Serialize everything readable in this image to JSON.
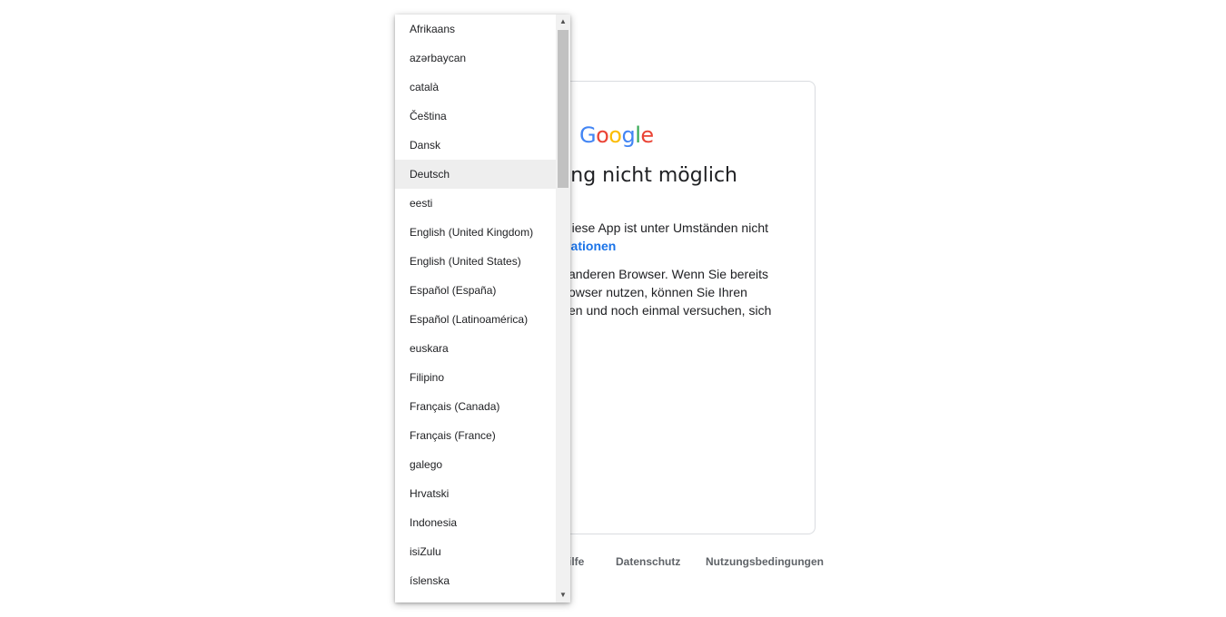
{
  "logo": {
    "letters": [
      "G",
      "o",
      "o",
      "g",
      "l",
      "e"
    ],
    "colors": [
      "#4285F4",
      "#EA4335",
      "#FBBC05",
      "#4285F4",
      "#34A853",
      "#EA4335"
    ]
  },
  "card": {
    "heading": "ung nicht möglich",
    "para1_text": "iese App ist unter Umständen nicht",
    "para1_link": "nationen",
    "para2_lines": [
      "anderen Browser. Wenn Sie bereits",
      "owser nutzen, können Sie Ihren",
      "en und noch einmal versuchen, sich"
    ]
  },
  "footer": {
    "help": "ilfe",
    "privacy": "Datenschutz",
    "terms": "Nutzungsbedingungen"
  },
  "language_dropdown": {
    "selected": "Deutsch",
    "items": [
      "Afrikaans",
      "azərbaycan",
      "català",
      "Čeština",
      "Dansk",
      "Deutsch",
      "eesti",
      "English (United Kingdom)",
      "English (United States)",
      "Español (España)",
      "Español (Latinoamérica)",
      "euskara",
      "Filipino",
      "Français (Canada)",
      "Français (France)",
      "galego",
      "Hrvatski",
      "Indonesia",
      "isiZulu",
      "íslenska"
    ],
    "scroll_up_icon": "triangle-up-icon",
    "scroll_down_icon": "triangle-down-icon"
  },
  "accent_color": "#1a73e8"
}
